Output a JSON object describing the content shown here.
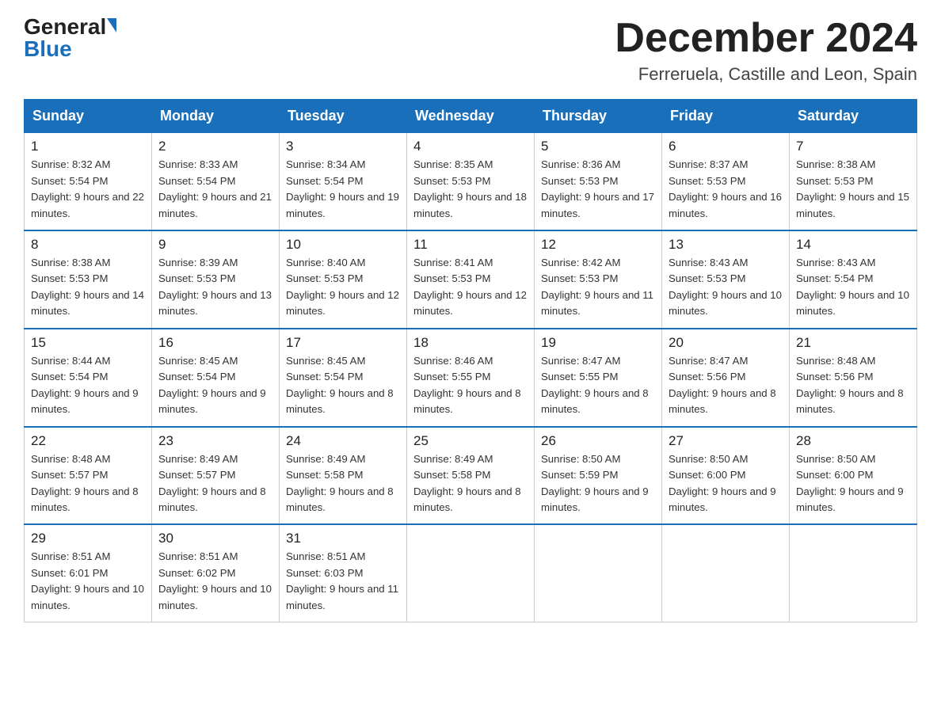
{
  "logo": {
    "general": "General",
    "blue": "Blue"
  },
  "title": "December 2024",
  "subtitle": "Ferreruela, Castille and Leon, Spain",
  "days_of_week": [
    "Sunday",
    "Monday",
    "Tuesday",
    "Wednesday",
    "Thursday",
    "Friday",
    "Saturday"
  ],
  "weeks": [
    [
      {
        "day": "1",
        "sunrise": "8:32 AM",
        "sunset": "5:54 PM",
        "daylight": "9 hours and 22 minutes."
      },
      {
        "day": "2",
        "sunrise": "8:33 AM",
        "sunset": "5:54 PM",
        "daylight": "9 hours and 21 minutes."
      },
      {
        "day": "3",
        "sunrise": "8:34 AM",
        "sunset": "5:54 PM",
        "daylight": "9 hours and 19 minutes."
      },
      {
        "day": "4",
        "sunrise": "8:35 AM",
        "sunset": "5:53 PM",
        "daylight": "9 hours and 18 minutes."
      },
      {
        "day": "5",
        "sunrise": "8:36 AM",
        "sunset": "5:53 PM",
        "daylight": "9 hours and 17 minutes."
      },
      {
        "day": "6",
        "sunrise": "8:37 AM",
        "sunset": "5:53 PM",
        "daylight": "9 hours and 16 minutes."
      },
      {
        "day": "7",
        "sunrise": "8:38 AM",
        "sunset": "5:53 PM",
        "daylight": "9 hours and 15 minutes."
      }
    ],
    [
      {
        "day": "8",
        "sunrise": "8:38 AM",
        "sunset": "5:53 PM",
        "daylight": "9 hours and 14 minutes."
      },
      {
        "day": "9",
        "sunrise": "8:39 AM",
        "sunset": "5:53 PM",
        "daylight": "9 hours and 13 minutes."
      },
      {
        "day": "10",
        "sunrise": "8:40 AM",
        "sunset": "5:53 PM",
        "daylight": "9 hours and 12 minutes."
      },
      {
        "day": "11",
        "sunrise": "8:41 AM",
        "sunset": "5:53 PM",
        "daylight": "9 hours and 12 minutes."
      },
      {
        "day": "12",
        "sunrise": "8:42 AM",
        "sunset": "5:53 PM",
        "daylight": "9 hours and 11 minutes."
      },
      {
        "day": "13",
        "sunrise": "8:43 AM",
        "sunset": "5:53 PM",
        "daylight": "9 hours and 10 minutes."
      },
      {
        "day": "14",
        "sunrise": "8:43 AM",
        "sunset": "5:54 PM",
        "daylight": "9 hours and 10 minutes."
      }
    ],
    [
      {
        "day": "15",
        "sunrise": "8:44 AM",
        "sunset": "5:54 PM",
        "daylight": "9 hours and 9 minutes."
      },
      {
        "day": "16",
        "sunrise": "8:45 AM",
        "sunset": "5:54 PM",
        "daylight": "9 hours and 9 minutes."
      },
      {
        "day": "17",
        "sunrise": "8:45 AM",
        "sunset": "5:54 PM",
        "daylight": "9 hours and 8 minutes."
      },
      {
        "day": "18",
        "sunrise": "8:46 AM",
        "sunset": "5:55 PM",
        "daylight": "9 hours and 8 minutes."
      },
      {
        "day": "19",
        "sunrise": "8:47 AM",
        "sunset": "5:55 PM",
        "daylight": "9 hours and 8 minutes."
      },
      {
        "day": "20",
        "sunrise": "8:47 AM",
        "sunset": "5:56 PM",
        "daylight": "9 hours and 8 minutes."
      },
      {
        "day": "21",
        "sunrise": "8:48 AM",
        "sunset": "5:56 PM",
        "daylight": "9 hours and 8 minutes."
      }
    ],
    [
      {
        "day": "22",
        "sunrise": "8:48 AM",
        "sunset": "5:57 PM",
        "daylight": "9 hours and 8 minutes."
      },
      {
        "day": "23",
        "sunrise": "8:49 AM",
        "sunset": "5:57 PM",
        "daylight": "9 hours and 8 minutes."
      },
      {
        "day": "24",
        "sunrise": "8:49 AM",
        "sunset": "5:58 PM",
        "daylight": "9 hours and 8 minutes."
      },
      {
        "day": "25",
        "sunrise": "8:49 AM",
        "sunset": "5:58 PM",
        "daylight": "9 hours and 8 minutes."
      },
      {
        "day": "26",
        "sunrise": "8:50 AM",
        "sunset": "5:59 PM",
        "daylight": "9 hours and 9 minutes."
      },
      {
        "day": "27",
        "sunrise": "8:50 AM",
        "sunset": "6:00 PM",
        "daylight": "9 hours and 9 minutes."
      },
      {
        "day": "28",
        "sunrise": "8:50 AM",
        "sunset": "6:00 PM",
        "daylight": "9 hours and 9 minutes."
      }
    ],
    [
      {
        "day": "29",
        "sunrise": "8:51 AM",
        "sunset": "6:01 PM",
        "daylight": "9 hours and 10 minutes."
      },
      {
        "day": "30",
        "sunrise": "8:51 AM",
        "sunset": "6:02 PM",
        "daylight": "9 hours and 10 minutes."
      },
      {
        "day": "31",
        "sunrise": "8:51 AM",
        "sunset": "6:03 PM",
        "daylight": "9 hours and 11 minutes."
      },
      null,
      null,
      null,
      null
    ]
  ]
}
